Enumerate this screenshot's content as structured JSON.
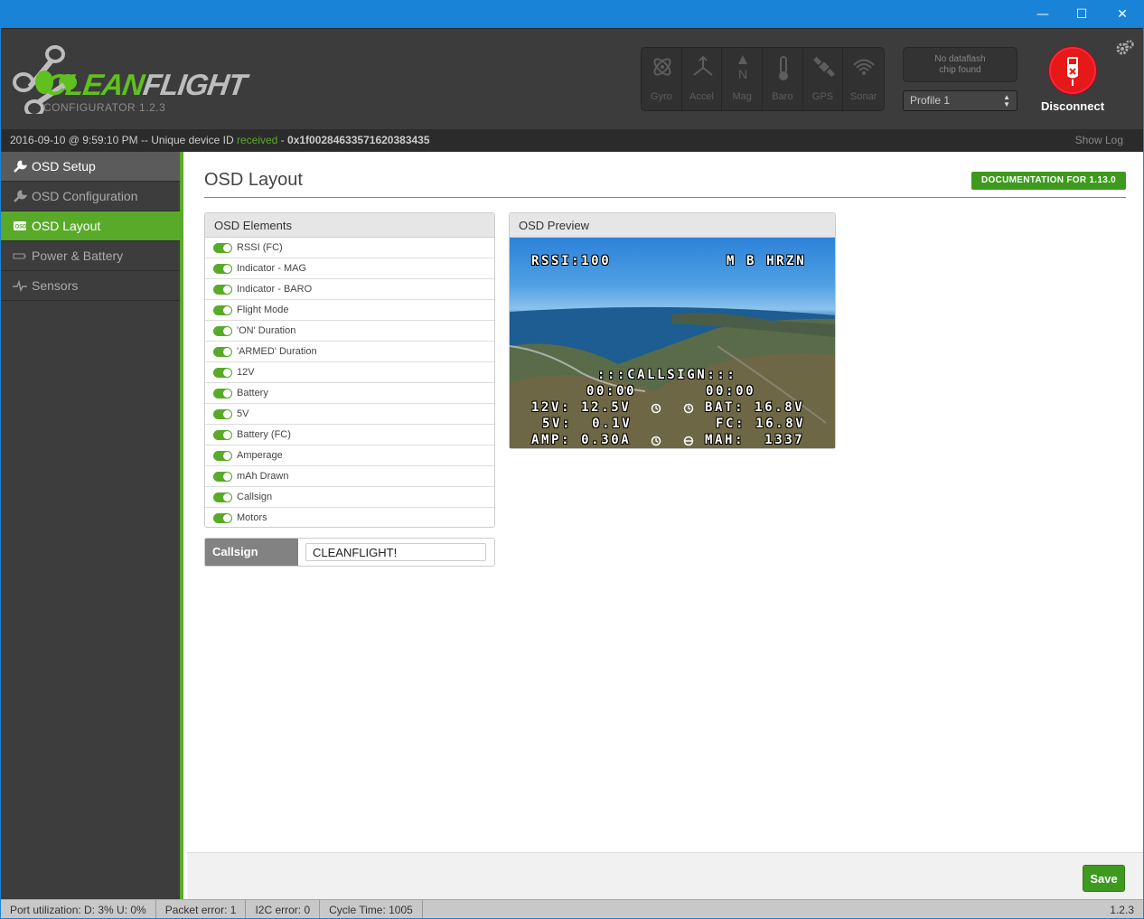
{
  "window": {
    "minimize_glyph": "—",
    "maximize_glyph": "☐",
    "close_glyph": "✕"
  },
  "header": {
    "logo_clean": "CLEAN",
    "logo_flight": "FLIGHT",
    "configurator_version": "CONFIGURATOR  1.2.3",
    "sensors": [
      {
        "label": "Gyro",
        "icon": "gyro-icon"
      },
      {
        "label": "Accel",
        "icon": "accel-icon"
      },
      {
        "label": "Mag",
        "icon": "mag-icon"
      },
      {
        "label": "Baro",
        "icon": "baro-icon"
      },
      {
        "label": "GPS",
        "icon": "gps-icon"
      },
      {
        "label": "Sonar",
        "icon": "sonar-icon"
      }
    ],
    "dataflash_line1": "No dataflash",
    "dataflash_line2": "chip found",
    "profile_selected": "Profile 1",
    "disconnect_label": "Disconnect"
  },
  "statusline": {
    "prefix": "2016-09-10 @ 9:59:10 PM -- Unique device ID ",
    "received": "received",
    "separator": " - ",
    "device_id": "0x1f00284633571620383435",
    "show_log": "Show Log"
  },
  "sidebar": {
    "items": [
      {
        "label": "OSD Setup",
        "icon": "wrench-icon"
      },
      {
        "label": "OSD Configuration",
        "icon": "wrench-icon"
      },
      {
        "label": "OSD Layout",
        "icon": "osd-icon"
      },
      {
        "label": "Power & Battery",
        "icon": "battery-icon"
      },
      {
        "label": "Sensors",
        "icon": "pulse-icon"
      }
    ]
  },
  "main": {
    "title": "OSD Layout",
    "doc_button": "DOCUMENTATION FOR 1.13.0",
    "elements_header": "OSD Elements",
    "elements": [
      {
        "label": "RSSI (FC)",
        "enabled": true
      },
      {
        "label": "Indicator - MAG",
        "enabled": true
      },
      {
        "label": "Indicator - BARO",
        "enabled": true
      },
      {
        "label": "Flight Mode",
        "enabled": true
      },
      {
        "label": "'ON' Duration",
        "enabled": true
      },
      {
        "label": "'ARMED' Duration",
        "enabled": true
      },
      {
        "label": "12V",
        "enabled": true
      },
      {
        "label": "Battery",
        "enabled": true
      },
      {
        "label": "5V",
        "enabled": true
      },
      {
        "label": "Battery (FC)",
        "enabled": true
      },
      {
        "label": "Amperage",
        "enabled": true
      },
      {
        "label": "mAh Drawn",
        "enabled": true
      },
      {
        "label": "Callsign",
        "enabled": true
      },
      {
        "label": "Motors",
        "enabled": true
      }
    ],
    "callsign_label": "Callsign",
    "callsign_value": "CLEANFLIGHT!",
    "preview_header": "OSD Preview",
    "osd": {
      "rssi": "RSSI:100",
      "mode": "M B HRZN",
      "callsign": ":::CALLSIGN:::",
      "on_time": "00:00",
      "armed_time": "00:00",
      "v12": "12V: 12.5V",
      "bat": "BAT: 16.8V",
      "v5": "5V:  0.1V",
      "fc": "FC: 16.8V",
      "amp": "AMP: 0.30A",
      "mah": "MAH:  1337"
    },
    "save_button": "Save"
  },
  "footer": {
    "port_utilization": "Port utilization: D: 3% U: 0%",
    "packet_error": "Packet error: 1",
    "i2c_error": "I2C error: 0",
    "cycle_time": "Cycle Time: 1005",
    "version": "1.2.3"
  },
  "colors": {
    "accent_green": "#59aa29",
    "titlebar_blue": "#1883d7",
    "disconnect_red": "#e61818"
  }
}
